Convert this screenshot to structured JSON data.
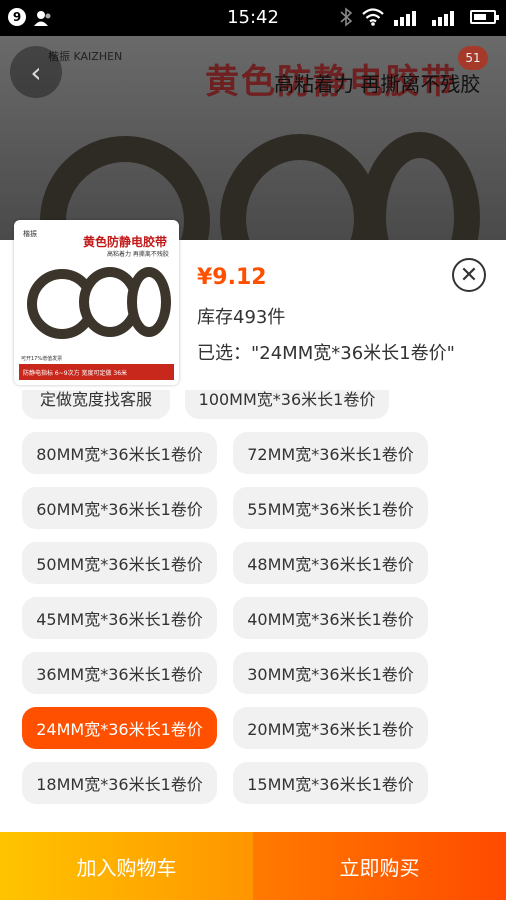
{
  "status_bar": {
    "notification_count": "9",
    "time": "15:42"
  },
  "banner": {
    "title": "黄色防静电胶带",
    "subtitle": "高粘着力 再撕离不残胶",
    "brand": "楷振 KAIZHEN",
    "cart_count": "51"
  },
  "product": {
    "thumb_title": "黄色防静电胶带",
    "thumb_subtitle": "高粘着力 再撕离不残胶",
    "thumb_brand": "楷振",
    "thumb_note": "可开17%增值发票",
    "thumb_strip": "防静电指标 6~9次方  宽度可定做 36米",
    "price": "¥9.12",
    "stock": "库存493件",
    "selected": "已选：\"24MM宽*36米长1卷价\""
  },
  "options": [
    {
      "label": "定做宽度找客服",
      "active": false
    },
    {
      "label": "100MM宽*36米长1卷价",
      "active": false
    },
    {
      "label": "80MM宽*36米长1卷价",
      "active": false
    },
    {
      "label": "72MM宽*36米长1卷价",
      "active": false
    },
    {
      "label": "60MM宽*36米长1卷价",
      "active": false
    },
    {
      "label": "55MM宽*36米长1卷价",
      "active": false
    },
    {
      "label": "50MM宽*36米长1卷价",
      "active": false
    },
    {
      "label": "48MM宽*36米长1卷价",
      "active": false
    },
    {
      "label": "45MM宽*36米长1卷价",
      "active": false
    },
    {
      "label": "40MM宽*36米长1卷价",
      "active": false
    },
    {
      "label": "36MM宽*36米长1卷价",
      "active": false
    },
    {
      "label": "30MM宽*36米长1卷价",
      "active": false
    },
    {
      "label": "24MM宽*36米长1卷价",
      "active": true
    },
    {
      "label": "20MM宽*36米长1卷价",
      "active": false
    },
    {
      "label": "18MM宽*36米长1卷价",
      "active": false
    },
    {
      "label": "15MM宽*36米长1卷价",
      "active": false
    }
  ],
  "footer": {
    "add_to_cart": "加入购物车",
    "buy_now": "立即购买"
  },
  "colors": {
    "accent": "#ff5000",
    "cart_button": "#ffb300",
    "buy_button": "#ff5a00"
  }
}
